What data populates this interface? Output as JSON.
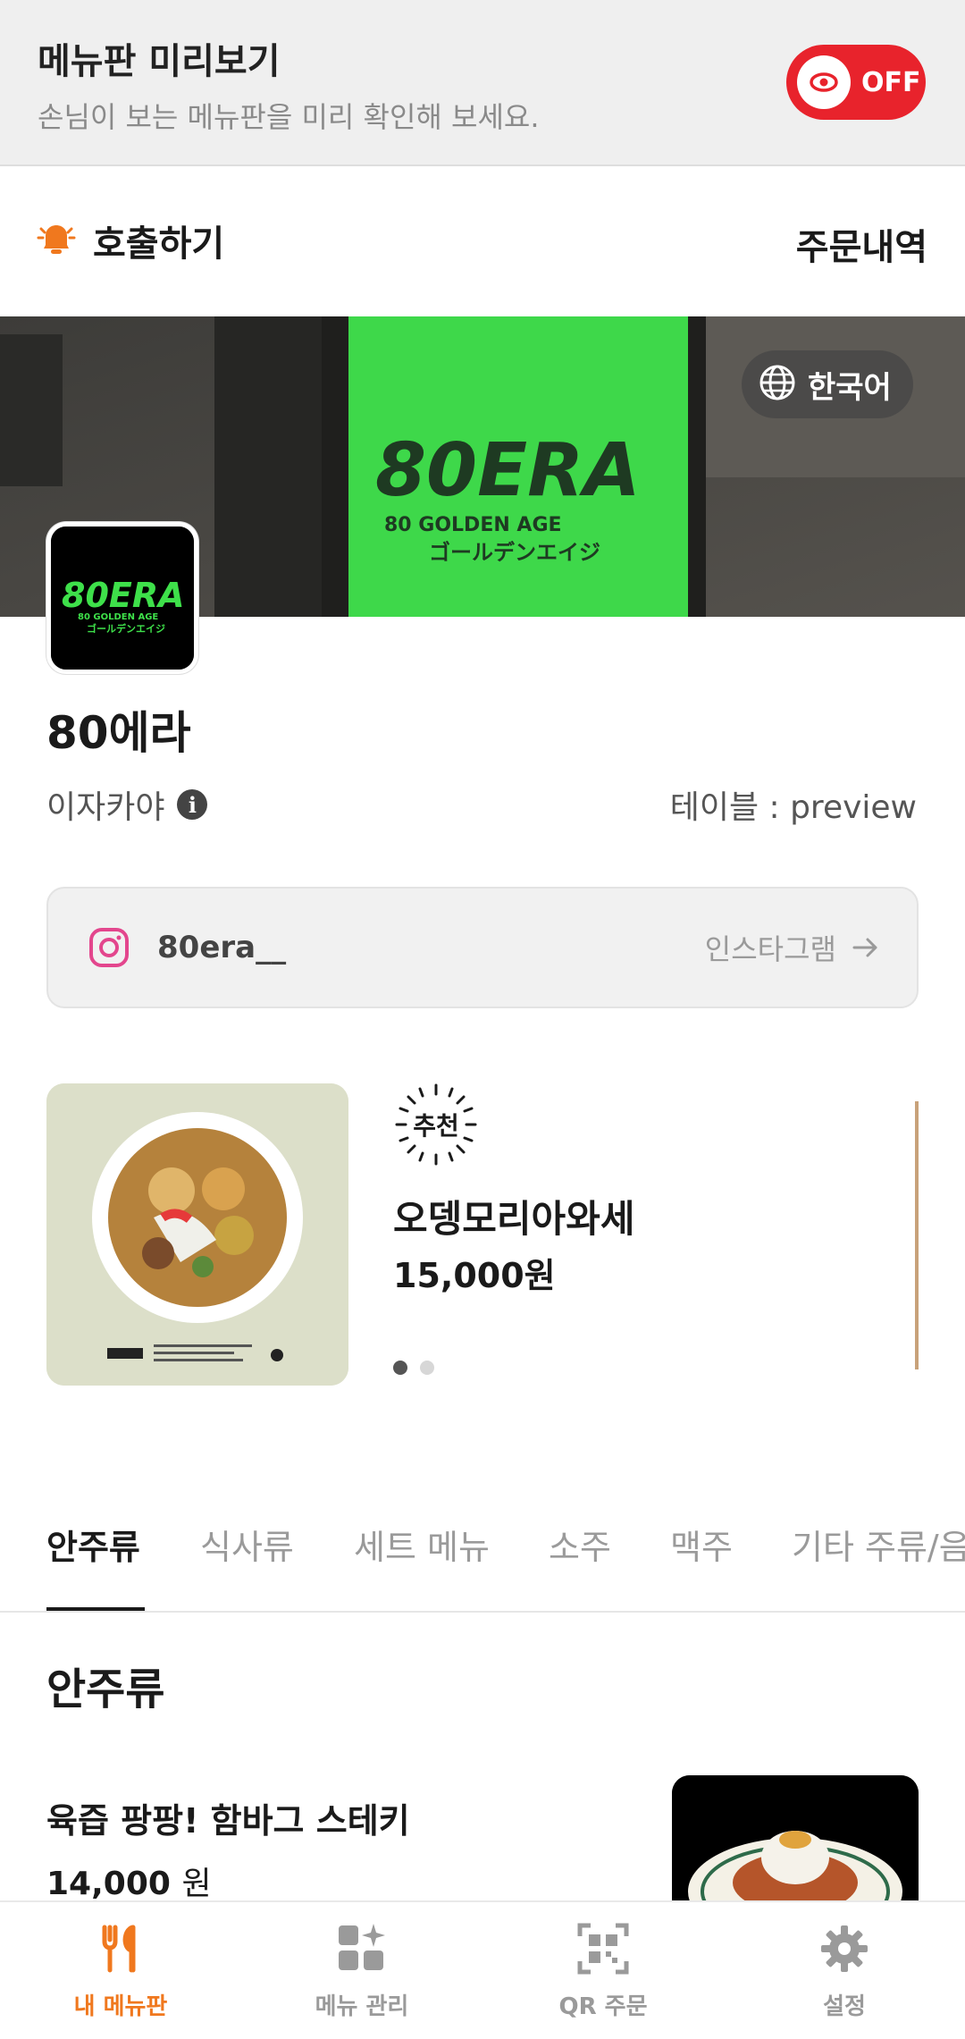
{
  "preview": {
    "title": "메뉴판 미리보기",
    "subtitle": "손님이 보는 메뉴판을 미리 확인해 보세요.",
    "toggle_label": "OFF",
    "toggle_color": "#e8232c"
  },
  "action_bar": {
    "call_label": "호출하기",
    "orders_label": "주문내역"
  },
  "cover": {
    "language_label": "한국어",
    "sign_text": "80ERA",
    "sign_sub1": "80 GOLDEN AGE",
    "sign_sub2": "ゴールデンエイジ"
  },
  "store": {
    "logo_text": "80ERA",
    "logo_sub1": "80 GOLDEN AGE",
    "logo_sub2": "ゴールデンエイジ",
    "name": "80에라",
    "category": "이자카야",
    "table_label": "테이블 : preview"
  },
  "instagram": {
    "handle": "80era__",
    "link_label": "인스타그램"
  },
  "recommend": {
    "badge": "추천",
    "name": "오뎅모리아와세",
    "price": "15,000원",
    "page_count": 2,
    "active_page": 1
  },
  "tabs": {
    "items": [
      "안주류",
      "식사류",
      "세트 메뉴",
      "소주",
      "맥주",
      "기타 주류/음"
    ],
    "active_index": 0
  },
  "section": {
    "title": "안주류"
  },
  "menu_item": {
    "name": "육즙 팡팡! 함바그 스테키",
    "price_number": "14,000",
    "price_unit": "원"
  },
  "bottom_nav": {
    "items": [
      {
        "label": "내 메뉴판",
        "icon": "fork-knife-icon",
        "active": true
      },
      {
        "label": "메뉴 관리",
        "icon": "grid-sparkle-icon",
        "active": false
      },
      {
        "label": "QR 주문",
        "icon": "qr-icon",
        "active": false
      },
      {
        "label": "설정",
        "icon": "gear-icon",
        "active": false
      }
    ],
    "active_color": "#f0781e",
    "inactive_color": "#9a9a9a"
  }
}
